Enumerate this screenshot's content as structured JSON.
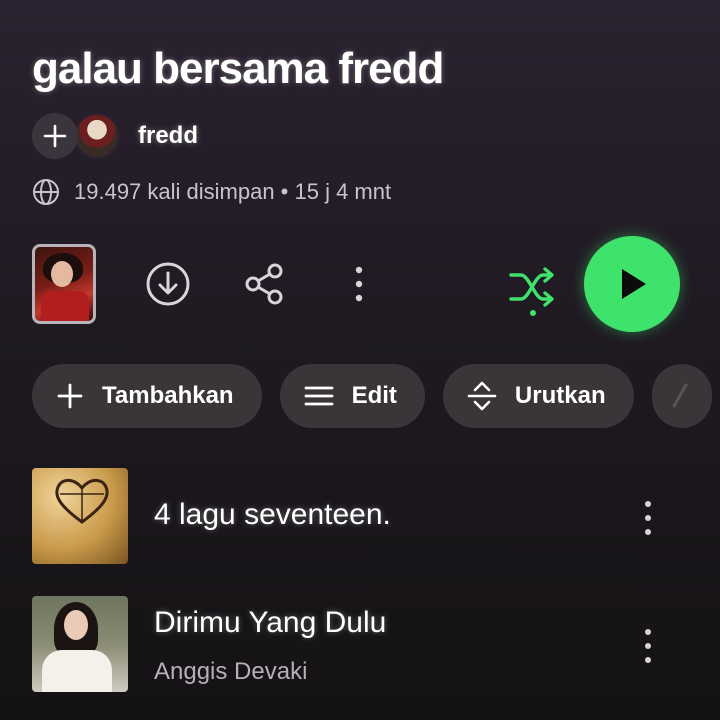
{
  "playlist": {
    "title": "galau bersama fredd",
    "owner": "fredd",
    "meta": "19.497 kali disimpan • 15 j 4 mnt"
  },
  "icons": {
    "add": "plus-icon",
    "globe": "globe-icon",
    "download": "download-icon",
    "share": "share-icon",
    "more": "more-vertical-icon",
    "shuffle": "shuffle-icon",
    "play": "play-icon",
    "edit": "list-icon",
    "sort": "sort-icon"
  },
  "colors": {
    "accent": "#3fe26a",
    "chip_bg": "#3a3539"
  },
  "chips": [
    {
      "label": "Tambahkan",
      "icon": "plus-icon"
    },
    {
      "label": "Edit",
      "icon": "list-icon"
    },
    {
      "label": "Urutkan",
      "icon": "sort-icon"
    }
  ],
  "tracks": [
    {
      "title": "4 lagu seventeen.",
      "artist": ""
    },
    {
      "title": "Dirimu Yang Dulu",
      "artist": "Anggis Devaki"
    }
  ]
}
